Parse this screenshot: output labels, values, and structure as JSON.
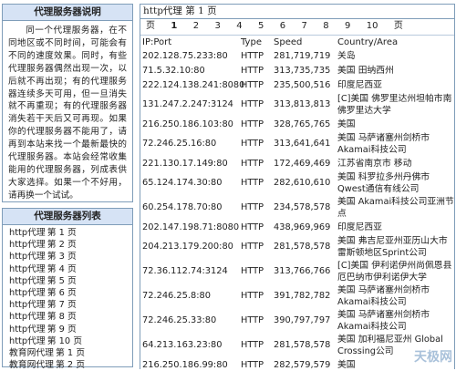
{
  "about": {
    "title": "代理服务器说明",
    "text": "同一个代理服务器，在不同地区或不同时间，可能会有不同的速度效果。同时，有些代理服务器偶然出现一次，以后就不再出现；有的代理服务器连续多天可用，但一旦消失就不再重现；有的代理服务器消失若干天后又可再现。如果你的代理服务器不能用了，请再到本站来找一个最新最快的代理服务器。本站会经常收集能用的代理服务器，列成表供大家选择。如果一个不好用，请再换一个试试。"
  },
  "proxy_list": {
    "title": "代理服务器列表",
    "items": [
      {
        "name": "http代理",
        "page": "第 1 页"
      },
      {
        "name": "http代理",
        "page": "第 2 页"
      },
      {
        "name": "http代理",
        "page": "第 3 页"
      },
      {
        "name": "http代理",
        "page": "第 4 页"
      },
      {
        "name": "http代理",
        "page": "第 5 页"
      },
      {
        "name": "http代理",
        "page": "第 6 页"
      },
      {
        "name": "http代理",
        "page": "第 7 页"
      },
      {
        "name": "http代理",
        "page": "第 8 页"
      },
      {
        "name": "http代理",
        "page": "第 9 页"
      },
      {
        "name": "http代理",
        "page": "第 10 页"
      },
      {
        "name": "教育网代理",
        "page": "第 1 页"
      },
      {
        "name": "教育网代理",
        "page": "第 2 页"
      }
    ]
  },
  "main": {
    "title": "http代理 第 1 页",
    "pager": {
      "prefix": "页",
      "pages": [
        "1",
        "2",
        "3",
        "4",
        "5",
        "6",
        "7",
        "8",
        "9",
        "10"
      ],
      "suffix": "页",
      "current": "1"
    },
    "columns": [
      "IP:Port",
      "Type",
      "Speed",
      "Country/Area"
    ],
    "rows": [
      {
        "ip": "202.128.75.233:80",
        "type": "HTTP",
        "speed": "281,719,719",
        "area": "关岛"
      },
      {
        "ip": "71.5.32.10:80",
        "type": "HTTP",
        "speed": "313,735,735",
        "area": "美国 田纳西州"
      },
      {
        "ip": "222.124.138.241:8080",
        "type": "HTTP",
        "speed": "235,500,516",
        "area": "印度尼西亚"
      },
      {
        "ip": "131.247.2.247:3124",
        "type": "HTTP",
        "speed": "313,813,813",
        "area": "[C]美国 佛罗里达州坦帕市南佛罗里达大学"
      },
      {
        "ip": "216.250.186.103:80",
        "type": "HTTP",
        "speed": "328,765,765",
        "area": "美国"
      },
      {
        "ip": "72.246.25.16:80",
        "type": "HTTP",
        "speed": "313,641,641",
        "area": "美国 马萨诸塞州剑桥市Akamai科技公司"
      },
      {
        "ip": "221.130.17.149:80",
        "type": "HTTP",
        "speed": "172,469,469",
        "area": "江苏省南京市 移动"
      },
      {
        "ip": "65.124.174.30:80",
        "type": "HTTP",
        "speed": "282,610,610",
        "area": "美国 科罗拉多州丹佛市Qwest通信有线公司"
      },
      {
        "ip": "60.254.178.70:80",
        "type": "HTTP",
        "speed": "234,578,578",
        "area": "美国 Akamai科技公司亚洲节点"
      },
      {
        "ip": "202.147.198.71:8080",
        "type": "HTTP",
        "speed": "438,969,969",
        "area": "印度尼西亚"
      },
      {
        "ip": "204.213.179.200:80",
        "type": "HTTP",
        "speed": "281,578,578",
        "area": "美国 弗吉尼亚州亚历山大市雷斯顿地区Sprint公司"
      },
      {
        "ip": "72.36.112.74:3124",
        "type": "HTTP",
        "speed": "313,766,766",
        "area": "[C]美国 伊利诺伊州尚佩恩县厄巴纳市伊利诺伊大学"
      },
      {
        "ip": "72.246.25.8:80",
        "type": "HTTP",
        "speed": "391,782,782",
        "area": "美国 马萨诸塞州剑桥市Akamai科技公司"
      },
      {
        "ip": "72.246.25.33:80",
        "type": "HTTP",
        "speed": "390,797,797",
        "area": "美国 马萨诸塞州剑桥市Akamai科技公司"
      },
      {
        "ip": "64.213.163.23:80",
        "type": "HTTP",
        "speed": "281,578,578",
        "area": "美国 加利福尼亚州 Global Crossing公司"
      },
      {
        "ip": "216.250.186.99:80",
        "type": "HTTP",
        "speed": "282,579,579",
        "area": "美国"
      }
    ]
  },
  "watermark": "天极网"
}
